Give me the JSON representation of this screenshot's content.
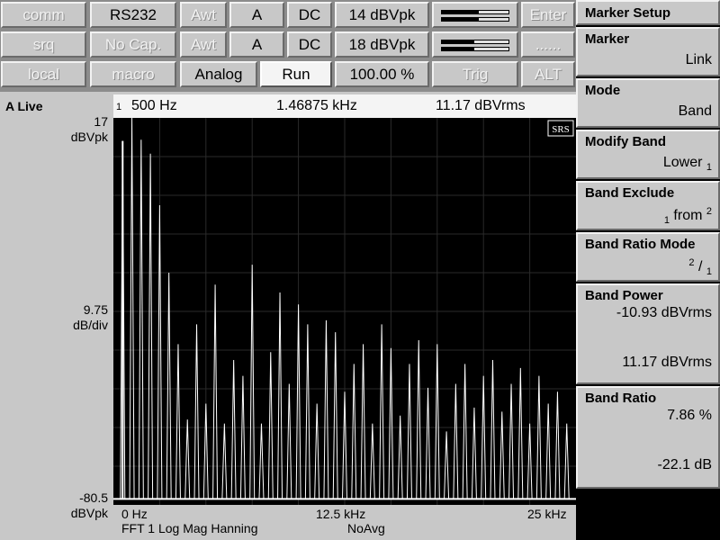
{
  "toolbar": {
    "row1": {
      "comm": "comm",
      "rs232": "RS232",
      "awt": "Awt",
      "a": "A",
      "dc": "DC",
      "range": "14 dBVpk",
      "enter": "Enter"
    },
    "row2": {
      "srq": "srq",
      "nocap": "No Cap.",
      "awt": "Awt",
      "a": "A",
      "dc": "DC",
      "range": "18 dBVpk",
      "dots": "......"
    },
    "row3": {
      "local": "local",
      "macro": "macro",
      "analog": "Analog",
      "run": "Run",
      "percent": "100.00 %",
      "trig": "Trig",
      "alt": "ALT"
    },
    "meter1_level": 0.55,
    "meter2_level": 0.48
  },
  "sidebar": {
    "title": "Marker Setup",
    "marker": {
      "label": "Marker",
      "value": "Link"
    },
    "mode": {
      "label": "Mode",
      "value": "Band"
    },
    "modify_band": {
      "label": "Modify Band",
      "value": "Lower",
      "sub": "1"
    },
    "band_exclude": {
      "label": "Band Exclude",
      "pre": "1",
      "mid": "from",
      "post": "2"
    },
    "band_ratio_mode": {
      "label": "Band Ratio Mode",
      "sup": "2",
      "slash": "/",
      "sub": "1"
    },
    "band_power": {
      "label": "Band Power",
      "value1": "-10.93 dBVrms",
      "value2": "11.17 dBVrms"
    },
    "band_ratio": {
      "label": "Band Ratio",
      "value1": "7.86 %",
      "value2": "-22.1 dB"
    }
  },
  "display": {
    "trace_label": "A Live",
    "marker_num": "1",
    "marker_freq": "500 Hz",
    "center_freq": "1.46875 kHz",
    "marker_amp": "11.17 dBVrms",
    "y_top": "17",
    "y_top_unit": "dBVpk",
    "y_scale": "9.75",
    "y_scale_unit": "dB/div",
    "y_bottom": "-80.5",
    "y_bottom_unit": "dBVpk",
    "x_start": "0 Hz",
    "x_mid": "12.5 kHz",
    "x_end": "25 kHz",
    "measurement": "FFT 1 Log Mag Hanning",
    "averaging": "NoAvg",
    "logo": "SRS"
  },
  "colors": {
    "panel": "#c8c8c8",
    "plot_bg": "#000000",
    "trace": "#ffffff"
  },
  "chart_data": {
    "type": "line",
    "x_unit": "kHz",
    "y_unit": "dBVpk",
    "xlim": [
      0,
      25
    ],
    "ylim": [
      -80.5,
      17
    ],
    "grid": true,
    "peaks": [
      {
        "x": 0.5,
        "y": 11.2
      },
      {
        "x": 1.0,
        "y": 17.0
      },
      {
        "x": 1.5,
        "y": 11.5
      },
      {
        "x": 2.0,
        "y": 8.0
      },
      {
        "x": 2.5,
        "y": -5.0
      },
      {
        "x": 3.0,
        "y": -22.0
      },
      {
        "x": 3.5,
        "y": -40.0
      },
      {
        "x": 4.0,
        "y": -59.0
      },
      {
        "x": 4.5,
        "y": -35.0
      },
      {
        "x": 5.0,
        "y": -55.0
      },
      {
        "x": 5.5,
        "y": -25.0
      },
      {
        "x": 6.0,
        "y": -60.0
      },
      {
        "x": 6.5,
        "y": -44.0
      },
      {
        "x": 7.0,
        "y": -48.0
      },
      {
        "x": 7.5,
        "y": -20.0
      },
      {
        "x": 8.0,
        "y": -60.0
      },
      {
        "x": 8.5,
        "y": -42.0
      },
      {
        "x": 9.0,
        "y": -27.0
      },
      {
        "x": 9.5,
        "y": -50.0
      },
      {
        "x": 10.0,
        "y": -30.0
      },
      {
        "x": 10.5,
        "y": -35.0
      },
      {
        "x": 11.0,
        "y": -55.0
      },
      {
        "x": 11.5,
        "y": -34.0
      },
      {
        "x": 12.0,
        "y": -37.0
      },
      {
        "x": 12.5,
        "y": -52.0
      },
      {
        "x": 13.0,
        "y": -45.0
      },
      {
        "x": 13.5,
        "y": -40.0
      },
      {
        "x": 14.0,
        "y": -60.0
      },
      {
        "x": 14.5,
        "y": -35.0
      },
      {
        "x": 15.0,
        "y": -41.0
      },
      {
        "x": 15.5,
        "y": -58.0
      },
      {
        "x": 16.0,
        "y": -45.0
      },
      {
        "x": 16.5,
        "y": -39.0
      },
      {
        "x": 17.0,
        "y": -51.0
      },
      {
        "x": 17.5,
        "y": -40.0
      },
      {
        "x": 18.0,
        "y": -62.0
      },
      {
        "x": 18.5,
        "y": -50.0
      },
      {
        "x": 19.0,
        "y": -45.0
      },
      {
        "x": 19.5,
        "y": -56.0
      },
      {
        "x": 20.0,
        "y": -48.0
      },
      {
        "x": 20.5,
        "y": -44.0
      },
      {
        "x": 21.0,
        "y": -57.0
      },
      {
        "x": 21.5,
        "y": -50.0
      },
      {
        "x": 22.0,
        "y": -46.0
      },
      {
        "x": 22.5,
        "y": -60.0
      },
      {
        "x": 23.0,
        "y": -48.0
      },
      {
        "x": 23.5,
        "y": -55.0
      },
      {
        "x": 24.0,
        "y": -52.0
      },
      {
        "x": 24.5,
        "y": -60.0
      }
    ]
  }
}
